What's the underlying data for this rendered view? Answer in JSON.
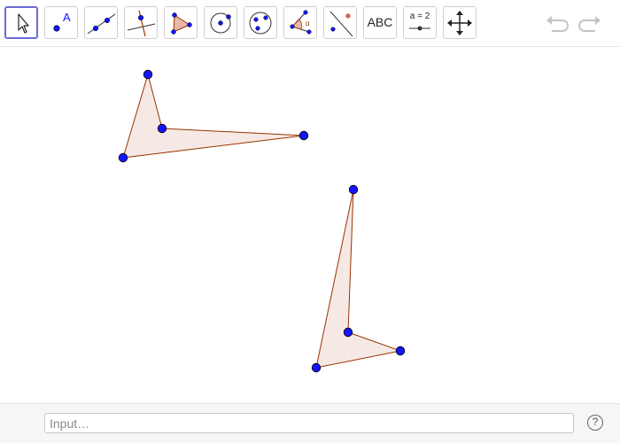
{
  "toolbar": {
    "tools": [
      {
        "name": "move-tool",
        "icon": "arrow-cursor-icon",
        "selected": true
      },
      {
        "name": "point-tool",
        "icon": "point-icon",
        "label": "A"
      },
      {
        "name": "line-tool",
        "icon": "line-icon"
      },
      {
        "name": "perpendicular-line-tool",
        "icon": "perpendicular-line-icon"
      },
      {
        "name": "polygon-tool",
        "icon": "polygon-icon"
      },
      {
        "name": "circle-tool",
        "icon": "circle-center-point-icon"
      },
      {
        "name": "ellipse-tool",
        "icon": "ellipse-icon"
      },
      {
        "name": "angle-tool",
        "icon": "angle-icon",
        "label": "α"
      },
      {
        "name": "reflect-tool",
        "icon": "reflect-about-line-icon"
      },
      {
        "name": "text-tool",
        "icon": "text-icon",
        "label": "ABC"
      },
      {
        "name": "slider-tool",
        "icon": "slider-icon",
        "label": "a = 2"
      },
      {
        "name": "move-graphics-view-tool",
        "icon": "move-arrows-icon"
      }
    ],
    "undo_icon": "undo-icon",
    "redo_icon": "redo-icon"
  },
  "input": {
    "placeholder": "Input…",
    "value": ""
  },
  "help": {
    "label": "?"
  },
  "colors": {
    "point_fill": "#1414ff",
    "polygon_stroke": "#993300",
    "polygon_fill": "#f6e9e5",
    "selected_tool_border": "#6b6bd8"
  }
}
